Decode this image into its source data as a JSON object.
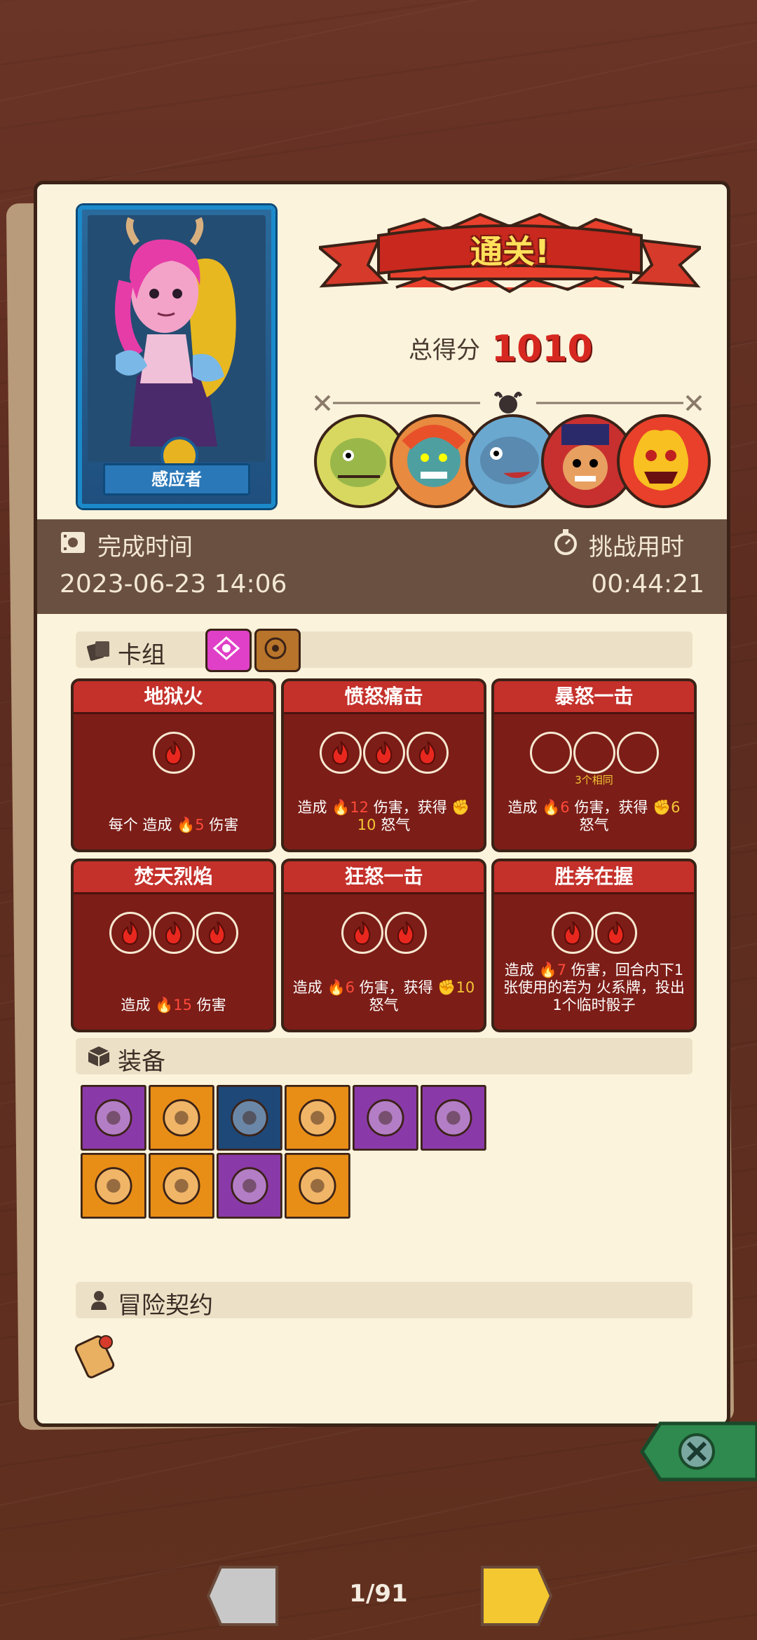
{
  "hero": {
    "name": "感应者"
  },
  "result": {
    "banner": "通关!",
    "score_label": "总得分",
    "score_value": "1010"
  },
  "bosses": [
    "green-lizard-boss-icon",
    "orange-ogre-boss-icon",
    "blue-fish-boss-icon",
    "red-hat-boss-icon",
    "fire-demon-boss-icon"
  ],
  "times": {
    "finish_label": "完成时间",
    "finish_value": "2023-06-23 14:06",
    "challenge_label": "挑战用时",
    "challenge_value": "00:44:21"
  },
  "sections": {
    "deck": "卡组",
    "equipment": "装备",
    "contract": "冒险契约"
  },
  "cards": [
    {
      "title": "地狱火",
      "dice": 1,
      "empty": false,
      "sub": "",
      "desc": [
        "每个",
        "造成",
        "5",
        "伤害"
      ]
    },
    {
      "title": "愤怒痛击",
      "dice": 3,
      "empty": false,
      "sub": "",
      "desc": [
        "造成",
        "12",
        "伤害，获得",
        "10",
        "怒气"
      ]
    },
    {
      "title": "暴怒一击",
      "dice": 3,
      "empty": true,
      "sub": "3个相同",
      "desc": [
        "造成",
        "6",
        "伤害，获得",
        "6",
        "怒气"
      ]
    },
    {
      "title": "焚天烈焰",
      "dice": 3,
      "empty": false,
      "sub": "",
      "desc": [
        "造成",
        "15",
        "伤害"
      ]
    },
    {
      "title": "狂怒一击",
      "dice": 2,
      "empty": false,
      "sub": "",
      "desc": [
        "造成",
        "6",
        "伤害，获得",
        "10",
        "怒气"
      ]
    },
    {
      "title": "胜券在握",
      "dice": 2,
      "empty": false,
      "sub": "",
      "desc": [
        "造成",
        "7",
        "伤害，回合内下1张使用的若为",
        "火系牌，投出1个临时骰子"
      ]
    }
  ],
  "equipment": [
    {
      "icon": "stone-cube-icon",
      "rarity": "purple"
    },
    {
      "icon": "green-feather-icon",
      "rarity": "orange"
    },
    {
      "icon": "golden-horn-icon",
      "rarity": "blue"
    },
    {
      "icon": "battle-axe-icon",
      "rarity": "orange"
    },
    {
      "icon": "silver-bell-icon",
      "rarity": "purple"
    },
    {
      "icon": "golden-die-icon",
      "rarity": "purple"
    },
    {
      "icon": "green-potion-icon",
      "rarity": "orange"
    },
    {
      "icon": "moss-tablet-icon",
      "rarity": "orange"
    },
    {
      "icon": "demon-shield-icon",
      "rarity": "purple"
    },
    {
      "icon": "golden-crown-icon",
      "rarity": "orange"
    }
  ],
  "contract_icon": "scroll-icon",
  "pager": {
    "text": "1/91"
  },
  "colors": {
    "fire_red": "#d62820",
    "board": "#fbf3dc",
    "time_band": "#6a5040"
  }
}
